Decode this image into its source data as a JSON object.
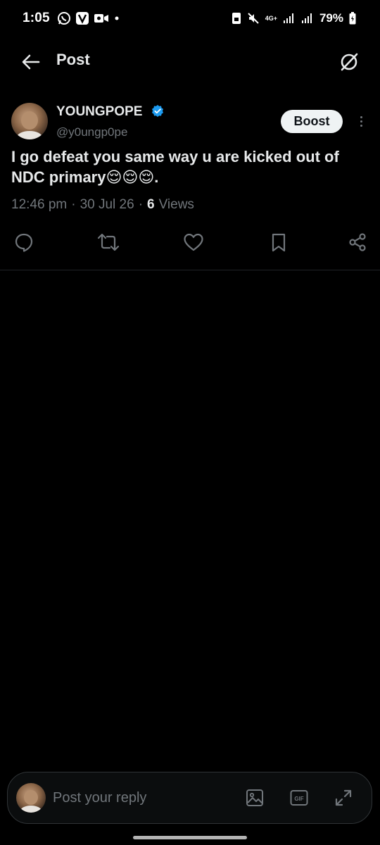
{
  "status_bar": {
    "time": "1:05",
    "network": "4G+",
    "battery": "79%"
  },
  "header": {
    "title": "Post",
    "back_icon": "arrow-left-icon",
    "grok_icon": "grok-icon"
  },
  "tweet": {
    "author_name": "YOUNGPOPE",
    "author_handle": "@y0ungp0pe",
    "boost_label": "Boost",
    "text": "I go defeat you same way u are kicked out of NDC primary😌😌😌.",
    "time": "12:46 pm",
    "date": "30 Jul 26",
    "views_count": "6",
    "views_label": "Views",
    "verified_color": "#1d9bf0"
  },
  "reply": {
    "placeholder": "Post your reply",
    "icons": [
      "image-icon",
      "gif-icon",
      "expand-icon"
    ]
  },
  "colors": {
    "background": "#000000",
    "text_primary": "#e7e9ea",
    "text_secondary": "#71767b",
    "accent": "#1d9bf0"
  }
}
